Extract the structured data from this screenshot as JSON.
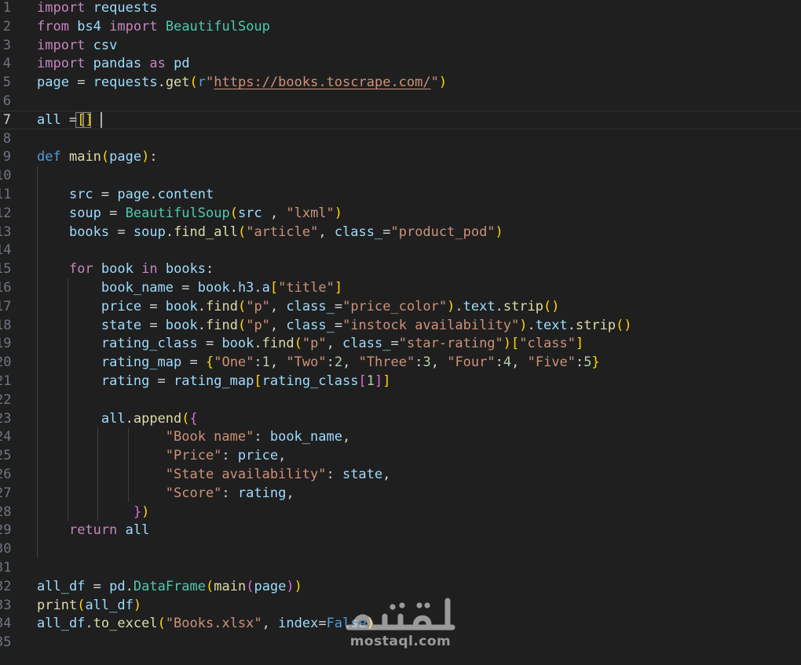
{
  "editor": {
    "language": "python",
    "current_line": 7,
    "lines": [
      {
        "n": "1",
        "tokens": [
          [
            "k",
            "import"
          ],
          [
            "o",
            " "
          ],
          [
            "v",
            "requests"
          ]
        ]
      },
      {
        "n": "2",
        "tokens": [
          [
            "k",
            "from"
          ],
          [
            "o",
            " "
          ],
          [
            "v",
            "bs4"
          ],
          [
            "o",
            " "
          ],
          [
            "k",
            "import"
          ],
          [
            "o",
            " "
          ],
          [
            "c",
            "BeautifulSoup"
          ]
        ]
      },
      {
        "n": "3",
        "tokens": [
          [
            "k",
            "import"
          ],
          [
            "o",
            " "
          ],
          [
            "v",
            "csv"
          ]
        ]
      },
      {
        "n": "4",
        "tokens": [
          [
            "k",
            "import"
          ],
          [
            "o",
            " "
          ],
          [
            "v",
            "pandas"
          ],
          [
            "o",
            " "
          ],
          [
            "k",
            "as"
          ],
          [
            "o",
            " "
          ],
          [
            "v",
            "pd"
          ]
        ]
      },
      {
        "n": "5",
        "tokens": [
          [
            "v",
            "page"
          ],
          [
            "o",
            " = "
          ],
          [
            "v",
            "requests"
          ],
          [
            "o",
            "."
          ],
          [
            "f",
            "get"
          ],
          [
            "p1",
            "("
          ],
          [
            "b",
            "r"
          ],
          [
            "s",
            "\""
          ],
          [
            "su",
            "https://books.toscrape.com/"
          ],
          [
            "s",
            "\""
          ],
          [
            "p1",
            ")"
          ]
        ]
      },
      {
        "n": "6",
        "tokens": []
      },
      {
        "n": "7",
        "tokens": [
          [
            "v",
            "all"
          ],
          [
            "o",
            " ="
          ],
          [
            "p1",
            "[]"
          ]
        ]
      },
      {
        "n": "8",
        "tokens": []
      },
      {
        "n": "9",
        "tokens": [
          [
            "d",
            "def"
          ],
          [
            "o",
            " "
          ],
          [
            "f",
            "main"
          ],
          [
            "p1",
            "("
          ],
          [
            "v",
            "page"
          ],
          [
            "p1",
            ")"
          ],
          [
            "o",
            ":"
          ]
        ]
      },
      {
        "n": "10",
        "tokens": []
      },
      {
        "n": "11",
        "tokens": [
          [
            "o",
            "    "
          ],
          [
            "v",
            "src"
          ],
          [
            "o",
            " = "
          ],
          [
            "v",
            "page"
          ],
          [
            "o",
            "."
          ],
          [
            "v",
            "content"
          ]
        ]
      },
      {
        "n": "12",
        "tokens": [
          [
            "o",
            "    "
          ],
          [
            "v",
            "soup"
          ],
          [
            "o",
            " = "
          ],
          [
            "c",
            "BeautifulSoup"
          ],
          [
            "p1",
            "("
          ],
          [
            "v",
            "src"
          ],
          [
            "o",
            " , "
          ],
          [
            "s",
            "\"lxml\""
          ],
          [
            "p1",
            ")"
          ]
        ]
      },
      {
        "n": "13",
        "tokens": [
          [
            "o",
            "    "
          ],
          [
            "v",
            "books"
          ],
          [
            "o",
            " = "
          ],
          [
            "v",
            "soup"
          ],
          [
            "o",
            "."
          ],
          [
            "f",
            "find_all"
          ],
          [
            "p1",
            "("
          ],
          [
            "s",
            "\"article\""
          ],
          [
            "o",
            ", "
          ],
          [
            "v",
            "class_"
          ],
          [
            "o",
            "="
          ],
          [
            "s",
            "\"product_pod\""
          ],
          [
            "p1",
            ")"
          ]
        ]
      },
      {
        "n": "14",
        "tokens": []
      },
      {
        "n": "15",
        "tokens": [
          [
            "o",
            "    "
          ],
          [
            "k",
            "for"
          ],
          [
            "o",
            " "
          ],
          [
            "v",
            "book"
          ],
          [
            "o",
            " "
          ],
          [
            "k",
            "in"
          ],
          [
            "o",
            " "
          ],
          [
            "v",
            "books"
          ],
          [
            "o",
            ":"
          ]
        ]
      },
      {
        "n": "16",
        "tokens": [
          [
            "o",
            "        "
          ],
          [
            "v",
            "book_name"
          ],
          [
            "o",
            " = "
          ],
          [
            "v",
            "book"
          ],
          [
            "o",
            "."
          ],
          [
            "v",
            "h3"
          ],
          [
            "o",
            "."
          ],
          [
            "v",
            "a"
          ],
          [
            "p1",
            "["
          ],
          [
            "s",
            "\"title\""
          ],
          [
            "p1",
            "]"
          ]
        ]
      },
      {
        "n": "17",
        "tokens": [
          [
            "o",
            "        "
          ],
          [
            "v",
            "price"
          ],
          [
            "o",
            " = "
          ],
          [
            "v",
            "book"
          ],
          [
            "o",
            "."
          ],
          [
            "f",
            "find"
          ],
          [
            "p1",
            "("
          ],
          [
            "s",
            "\"p\""
          ],
          [
            "o",
            ", "
          ],
          [
            "v",
            "class_"
          ],
          [
            "o",
            "="
          ],
          [
            "s",
            "\"price_color\""
          ],
          [
            "p1",
            ")"
          ],
          [
            "o",
            "."
          ],
          [
            "v",
            "text"
          ],
          [
            "o",
            "."
          ],
          [
            "f",
            "strip"
          ],
          [
            "p1",
            "()"
          ]
        ]
      },
      {
        "n": "18",
        "tokens": [
          [
            "o",
            "        "
          ],
          [
            "v",
            "state"
          ],
          [
            "o",
            " = "
          ],
          [
            "v",
            "book"
          ],
          [
            "o",
            "."
          ],
          [
            "f",
            "find"
          ],
          [
            "p1",
            "("
          ],
          [
            "s",
            "\"p\""
          ],
          [
            "o",
            ", "
          ],
          [
            "v",
            "class_"
          ],
          [
            "o",
            "="
          ],
          [
            "s",
            "\"instock availability\""
          ],
          [
            "p1",
            ")"
          ],
          [
            "o",
            "."
          ],
          [
            "v",
            "text"
          ],
          [
            "o",
            "."
          ],
          [
            "f",
            "strip"
          ],
          [
            "p1",
            "()"
          ]
        ]
      },
      {
        "n": "19",
        "tokens": [
          [
            "o",
            "        "
          ],
          [
            "v",
            "rating_class"
          ],
          [
            "o",
            " = "
          ],
          [
            "v",
            "book"
          ],
          [
            "o",
            "."
          ],
          [
            "f",
            "find"
          ],
          [
            "p1",
            "("
          ],
          [
            "s",
            "\"p\""
          ],
          [
            "o",
            ", "
          ],
          [
            "v",
            "class_"
          ],
          [
            "o",
            "="
          ],
          [
            "s",
            "\"star-rating\""
          ],
          [
            "p1",
            ")"
          ],
          [
            "p1",
            "["
          ],
          [
            "s",
            "\"class\""
          ],
          [
            "p1",
            "]"
          ]
        ]
      },
      {
        "n": "20",
        "tokens": [
          [
            "o",
            "        "
          ],
          [
            "v",
            "rating_map"
          ],
          [
            "o",
            " = "
          ],
          [
            "p1",
            "{"
          ],
          [
            "s",
            "\"One\""
          ],
          [
            "o",
            ":"
          ],
          [
            "n",
            "1"
          ],
          [
            "o",
            ", "
          ],
          [
            "s",
            "\"Two\""
          ],
          [
            "o",
            ":"
          ],
          [
            "n",
            "2"
          ],
          [
            "o",
            ", "
          ],
          [
            "s",
            "\"Three\""
          ],
          [
            "o",
            ":"
          ],
          [
            "n",
            "3"
          ],
          [
            "o",
            ", "
          ],
          [
            "s",
            "\"Four\""
          ],
          [
            "o",
            ":"
          ],
          [
            "n",
            "4"
          ],
          [
            "o",
            ", "
          ],
          [
            "s",
            "\"Five\""
          ],
          [
            "o",
            ":"
          ],
          [
            "n",
            "5"
          ],
          [
            "p1",
            "}"
          ]
        ]
      },
      {
        "n": "21",
        "tokens": [
          [
            "o",
            "        "
          ],
          [
            "v",
            "rating"
          ],
          [
            "o",
            " = "
          ],
          [
            "v",
            "rating_map"
          ],
          [
            "p1",
            "["
          ],
          [
            "v",
            "rating_class"
          ],
          [
            "p2",
            "["
          ],
          [
            "n",
            "1"
          ],
          [
            "p2",
            "]"
          ],
          [
            "p1",
            "]"
          ]
        ]
      },
      {
        "n": "22",
        "tokens": []
      },
      {
        "n": "23",
        "tokens": [
          [
            "o",
            "        "
          ],
          [
            "v",
            "all"
          ],
          [
            "o",
            "."
          ],
          [
            "f",
            "append"
          ],
          [
            "p1",
            "("
          ],
          [
            "p2",
            "{"
          ]
        ]
      },
      {
        "n": "24",
        "tokens": [
          [
            "o",
            "                "
          ],
          [
            "s",
            "\"Book name\""
          ],
          [
            "o",
            ": "
          ],
          [
            "v",
            "book_name"
          ],
          [
            "o",
            ","
          ]
        ]
      },
      {
        "n": "25",
        "tokens": [
          [
            "o",
            "                "
          ],
          [
            "s",
            "\"Price\""
          ],
          [
            "o",
            ": "
          ],
          [
            "v",
            "price"
          ],
          [
            "o",
            ","
          ]
        ]
      },
      {
        "n": "26",
        "tokens": [
          [
            "o",
            "                "
          ],
          [
            "s",
            "\"State availability\""
          ],
          [
            "o",
            ": "
          ],
          [
            "v",
            "state"
          ],
          [
            "o",
            ","
          ]
        ]
      },
      {
        "n": "27",
        "tokens": [
          [
            "o",
            "                "
          ],
          [
            "s",
            "\"Score\""
          ],
          [
            "o",
            ": "
          ],
          [
            "v",
            "rating"
          ],
          [
            "o",
            ","
          ]
        ]
      },
      {
        "n": "28",
        "tokens": [
          [
            "o",
            "            "
          ],
          [
            "p2",
            "}"
          ],
          [
            "p1",
            ")"
          ]
        ]
      },
      {
        "n": "29",
        "tokens": [
          [
            "o",
            "    "
          ],
          [
            "k",
            "return"
          ],
          [
            "o",
            " "
          ],
          [
            "v",
            "all"
          ]
        ]
      },
      {
        "n": "30",
        "tokens": []
      },
      {
        "n": "31",
        "tokens": []
      },
      {
        "n": "32",
        "tokens": [
          [
            "v",
            "all_df"
          ],
          [
            "o",
            " = "
          ],
          [
            "v",
            "pd"
          ],
          [
            "o",
            "."
          ],
          [
            "c",
            "DataFrame"
          ],
          [
            "p1",
            "("
          ],
          [
            "f",
            "main"
          ],
          [
            "p2",
            "("
          ],
          [
            "v",
            "page"
          ],
          [
            "p2",
            ")"
          ],
          [
            "p1",
            ")"
          ]
        ]
      },
      {
        "n": "33",
        "tokens": [
          [
            "f",
            "print"
          ],
          [
            "p1",
            "("
          ],
          [
            "v",
            "all_df"
          ],
          [
            "p1",
            ")"
          ]
        ]
      },
      {
        "n": "34",
        "tokens": [
          [
            "v",
            "all_df"
          ],
          [
            "o",
            "."
          ],
          [
            "f",
            "to_excel"
          ],
          [
            "p1",
            "("
          ],
          [
            "s",
            "\"Books.xlsx\""
          ],
          [
            "o",
            ", "
          ],
          [
            "v",
            "index"
          ],
          [
            "o",
            "="
          ],
          [
            "b",
            "False"
          ],
          [
            "p1",
            ")"
          ]
        ]
      },
      {
        "n": "35",
        "tokens": []
      }
    ]
  },
  "watermark": {
    "logo_text": "مستقل",
    "domain": "mostaql.com"
  }
}
